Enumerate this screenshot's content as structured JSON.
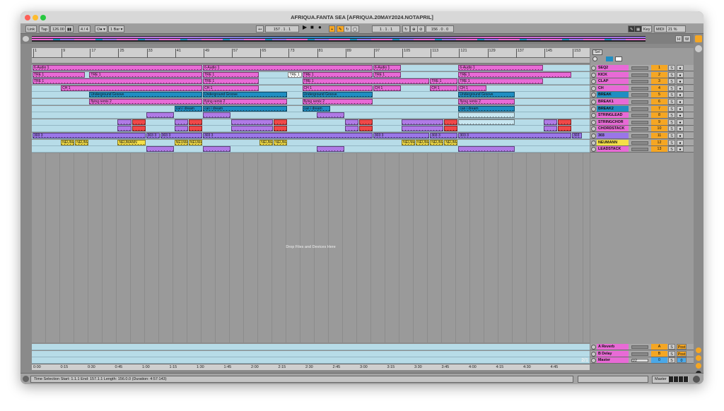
{
  "window": {
    "title": "AFRIQUA.FANTA SEA  [AFRIQUA.20MAY2024.NOTAPRIL]"
  },
  "controlbar": {
    "link": "Link",
    "tap": "Tap",
    "tempo": "126.00",
    "time_sig": "4 / 4",
    "metronome": "O● ▾",
    "quantize": "1 Bar ▾",
    "position": "157 .   1 .   1",
    "loop_start": "1 .   1 .   1",
    "loop_length": "156 .   0 .   0",
    "key": "Key",
    "midi": "MIDI",
    "cpu": "21 %"
  },
  "ruler": {
    "bars": [
      "1",
      "9",
      "17",
      "25",
      "33",
      "41",
      "49",
      "57",
      "65",
      "73",
      "81",
      "89",
      "97",
      "105",
      "113",
      "121",
      "129",
      "137",
      "145",
      "153"
    ],
    "set_label": "Set"
  },
  "timeline": {
    "times": [
      "0:00",
      "0:15",
      "0:30",
      "0:45",
      "1:00",
      "1:15",
      "1:30",
      "1:45",
      "2:00",
      "2:15",
      "2:30",
      "2:45",
      "3:00",
      "3:15",
      "3:30",
      "3:45",
      "4:00",
      "4:15",
      "4:30",
      "4:45"
    ],
    "page": "2/1"
  },
  "drop_text": "Drop Files and Devices Here",
  "colors": {
    "pink": "#e86ad6",
    "blue": "#1f8ec2",
    "purple": "#b07ae6",
    "violet": "#9a76e8",
    "red": "#f04848",
    "yellow": "#f5df48",
    "orange": "#f5a623",
    "lane": "#b7dce8"
  },
  "tracks": [
    {
      "name": "SEQ2",
      "num": "1",
      "color": "#e86ad6",
      "clips": [
        {
          "start": 1,
          "len": 48,
          "label": "6-Audio 1",
          "color": "#e86ad6"
        },
        {
          "start": 49,
          "len": 48,
          "label": "6-Audio 1",
          "color": "#e86ad6"
        },
        {
          "start": 97,
          "len": 8,
          "label": "6-Audio 1",
          "color": "#e86ad6"
        },
        {
          "start": 121,
          "len": 24,
          "label": "6-Audio 1",
          "color": "#e86ad6"
        }
      ]
    },
    {
      "name": "KICK",
      "num": "2",
      "color": "#e86ad6",
      "clips": [
        {
          "start": 1,
          "len": 15,
          "label": "TRE 1",
          "color": "#e86ad6"
        },
        {
          "start": 17,
          "len": 32,
          "label": "TRE 1",
          "color": "#e86ad6"
        },
        {
          "start": 49,
          "len": 16,
          "label": "TRE 1",
          "color": "#e86ad6"
        },
        {
          "start": 73,
          "len": 4,
          "label": "TRE 1",
          "color": "#ffffff"
        },
        {
          "start": 77,
          "len": 20,
          "label": "TRE 1",
          "color": "#e86ad6"
        },
        {
          "start": 97,
          "len": 8,
          "label": "TRE 1",
          "color": "#e86ad6"
        },
        {
          "start": 121,
          "len": 32,
          "label": "TRE 1",
          "color": "#e86ad6"
        }
      ]
    },
    {
      "name": "CLAP",
      "num": "3",
      "color": "#e86ad6",
      "clips": [
        {
          "start": 1,
          "len": 48,
          "label": "TRE 1",
          "color": "#e86ad6"
        },
        {
          "start": 49,
          "len": 16,
          "label": "TRE 1",
          "color": "#e86ad6"
        },
        {
          "start": 77,
          "len": 36,
          "label": "TRE 1",
          "color": "#e86ad6"
        },
        {
          "start": 113,
          "len": 8,
          "label": "TRE 1",
          "color": "#e86ad6"
        },
        {
          "start": 121,
          "len": 24,
          "label": "TRE 1",
          "color": "#e86ad6"
        }
      ]
    },
    {
      "name": "CH",
      "num": "4",
      "color": "#e86ad6",
      "clips": [
        {
          "start": 9,
          "len": 40,
          "label": "CH 1",
          "color": "#e86ad6"
        },
        {
          "start": 49,
          "len": 16,
          "label": "CH 1",
          "color": "#e86ad6"
        },
        {
          "start": 77,
          "len": 20,
          "label": "CH 1",
          "color": "#e86ad6"
        },
        {
          "start": 97,
          "len": 8,
          "label": "CH 1",
          "color": "#e86ad6"
        },
        {
          "start": 113,
          "len": 8,
          "label": "CH 1",
          "color": "#e86ad6"
        },
        {
          "start": 121,
          "len": 8,
          "label": "CH 1",
          "color": "#e86ad6"
        }
      ]
    },
    {
      "name": "BREAK",
      "num": "5",
      "color": "#1f8ec2",
      "clips": [
        {
          "start": 17,
          "len": 32,
          "label": "Underground Groove",
          "color": "#1f8ec2"
        },
        {
          "start": 49,
          "len": 24,
          "label": "Underground Groove",
          "color": "#1f8ec2"
        },
        {
          "start": 77,
          "len": 20,
          "label": "Underground Groove",
          "color": "#1f8ec2"
        },
        {
          "start": 121,
          "len": 16,
          "label": "Underground Groove",
          "color": "#1f8ec2"
        }
      ]
    },
    {
      "name": "BREAK1",
      "num": "6",
      "color": "#e86ad6",
      "clips": [
        {
          "start": 17,
          "len": 32,
          "label": "flying remix 2",
          "color": "#e86ad6"
        },
        {
          "start": 49,
          "len": 24,
          "label": "flying remix 2",
          "color": "#e86ad6"
        },
        {
          "start": 77,
          "len": 20,
          "label": "flying remix 2",
          "color": "#e86ad6"
        },
        {
          "start": 121,
          "len": 16,
          "label": "flying remix 2",
          "color": "#e86ad6"
        }
      ]
    },
    {
      "name": "BREAK2",
      "num": "7",
      "color": "#1f8ec2",
      "clips": [
        {
          "start": 41,
          "len": 8,
          "label": "can i dream",
          "color": "#1f8ec2"
        },
        {
          "start": 49,
          "len": 24,
          "label": "can i dream",
          "color": "#1f8ec2"
        },
        {
          "start": 77,
          "len": 8,
          "label": "can i dream",
          "color": "#1f8ec2"
        },
        {
          "start": 121,
          "len": 16,
          "label": "can i dream",
          "color": "#1f8ec2"
        }
      ]
    },
    {
      "name": "STRINGLEAD",
      "num": "8",
      "color": "#e86ad6",
      "clips": [
        {
          "start": 33,
          "len": 8,
          "label": "",
          "color": "#b07ae6"
        },
        {
          "start": 49,
          "len": 8,
          "label": "",
          "color": "#b07ae6"
        },
        {
          "start": 81,
          "len": 8,
          "label": "",
          "color": "#b07ae6"
        },
        {
          "start": 121,
          "len": 16,
          "label": "",
          "color": "#c8e6f0"
        }
      ]
    },
    {
      "name": "STRINGCHOR",
      "num": "9",
      "color": "#e86ad6",
      "clips": [
        {
          "start": 25,
          "len": 4,
          "label": "",
          "color": "#b07ae6"
        },
        {
          "start": 29,
          "len": 4,
          "label": "",
          "color": "#f04848"
        },
        {
          "start": 41,
          "len": 4,
          "label": "",
          "color": "#b07ae6"
        },
        {
          "start": 45,
          "len": 4,
          "label": "",
          "color": "#f04848"
        },
        {
          "start": 57,
          "len": 12,
          "label": "",
          "color": "#b07ae6"
        },
        {
          "start": 69,
          "len": 4,
          "label": "",
          "color": "#f04848"
        },
        {
          "start": 89,
          "len": 4,
          "label": "",
          "color": "#b07ae6"
        },
        {
          "start": 93,
          "len": 4,
          "label": "",
          "color": "#f04848"
        },
        {
          "start": 105,
          "len": 12,
          "label": "",
          "color": "#b07ae6"
        },
        {
          "start": 117,
          "len": 4,
          "label": "",
          "color": "#f04848"
        },
        {
          "start": 121,
          "len": 16,
          "label": "",
          "color": "#c8e6f0"
        },
        {
          "start": 145,
          "len": 4,
          "label": "",
          "color": "#b07ae6"
        },
        {
          "start": 149,
          "len": 4,
          "label": "",
          "color": "#f04848"
        }
      ]
    },
    {
      "name": "CHORDSTACK",
      "num": "10",
      "color": "#e86ad6",
      "clips": [
        {
          "start": 25,
          "len": 4,
          "label": "",
          "color": "#b07ae6"
        },
        {
          "start": 29,
          "len": 4,
          "label": "",
          "color": "#f04848"
        },
        {
          "start": 41,
          "len": 4,
          "label": "",
          "color": "#b07ae6"
        },
        {
          "start": 45,
          "len": 4,
          "label": "",
          "color": "#f04848"
        },
        {
          "start": 57,
          "len": 12,
          "label": "",
          "color": "#b07ae6"
        },
        {
          "start": 69,
          "len": 4,
          "label": "",
          "color": "#f04848"
        },
        {
          "start": 89,
          "len": 4,
          "label": "",
          "color": "#b07ae6"
        },
        {
          "start": 93,
          "len": 4,
          "label": "",
          "color": "#f04848"
        },
        {
          "start": 105,
          "len": 12,
          "label": "",
          "color": "#b07ae6"
        },
        {
          "start": 117,
          "len": 4,
          "label": "",
          "color": "#f04848"
        },
        {
          "start": 145,
          "len": 4,
          "label": "",
          "color": "#b07ae6"
        },
        {
          "start": 149,
          "len": 4,
          "label": "",
          "color": "#f04848"
        }
      ]
    },
    {
      "name": "303",
      "num": "11",
      "color": "#9a76e8",
      "clips": [
        {
          "start": 1,
          "len": 32,
          "label": "303 3",
          "color": "#9a76e8"
        },
        {
          "start": 33,
          "len": 4,
          "label": "303 3",
          "color": "#9a76e8"
        },
        {
          "start": 37,
          "len": 12,
          "label": "303 3",
          "color": "#9a76e8"
        },
        {
          "start": 49,
          "len": 48,
          "label": "303 3",
          "color": "#9a76e8"
        },
        {
          "start": 97,
          "len": 16,
          "label": "303 3",
          "color": "#9a76e8"
        },
        {
          "start": 113,
          "len": 8,
          "label": "303 3",
          "color": "#9a76e8"
        },
        {
          "start": 121,
          "len": 32,
          "label": "303 3",
          "color": "#9a76e8"
        },
        {
          "start": 153,
          "len": 3,
          "label": "303",
          "color": "#9a76e8"
        }
      ]
    },
    {
      "name": "NEUMANN",
      "num": "12",
      "color": "#f5df48",
      "clips": [
        {
          "start": 9,
          "len": 4,
          "label": "NEUMA",
          "color": "#f5df48"
        },
        {
          "start": 13,
          "len": 4,
          "label": "NEUMA",
          "color": "#f5df48"
        },
        {
          "start": 25,
          "len": 8,
          "label": "NEUMANN",
          "color": "#f5df48"
        },
        {
          "start": 41,
          "len": 4,
          "label": "NEUMA",
          "color": "#f5df48"
        },
        {
          "start": 45,
          "len": 4,
          "label": "NEUMA",
          "color": "#f5df48"
        },
        {
          "start": 65,
          "len": 4,
          "label": "NEUMA",
          "color": "#f5df48"
        },
        {
          "start": 69,
          "len": 4,
          "label": "NEUMA",
          "color": "#f5df48"
        },
        {
          "start": 105,
          "len": 4,
          "label": "NEUMA",
          "color": "#f5df48"
        },
        {
          "start": 109,
          "len": 4,
          "label": "NEUMA",
          "color": "#f5df48"
        },
        {
          "start": 113,
          "len": 4,
          "label": "NEUMA",
          "color": "#f5df48"
        },
        {
          "start": 117,
          "len": 4,
          "label": "NEUMA",
          "color": "#f5df48"
        }
      ]
    },
    {
      "name": "LEADSTACK",
      "num": "13",
      "color": "#e86ad6",
      "clips": [
        {
          "start": 33,
          "len": 8,
          "label": "",
          "color": "#b07ae6"
        },
        {
          "start": 49,
          "len": 8,
          "label": "",
          "color": "#b07ae6"
        },
        {
          "start": 81,
          "len": 8,
          "label": "",
          "color": "#b07ae6"
        },
        {
          "start": 121,
          "len": 16,
          "label": "",
          "color": "#b07ae6"
        }
      ]
    }
  ],
  "returns": [
    {
      "name": "A Reverb",
      "num": "A",
      "color": "#e86ad6",
      "btn": "Post"
    },
    {
      "name": "B Delay",
      "num": "B",
      "color": "#e86ad6",
      "btn": "Post"
    },
    {
      "name": "Master",
      "num": "0",
      "color": "#e86ad6",
      "btn": "0",
      "route": "1/2"
    }
  ],
  "status": {
    "text": "Time Selection   Start: 1.1.1   End: 157.1.1   Length: 156.0.0  (Duration: 4:57:143)",
    "master": "Master"
  }
}
